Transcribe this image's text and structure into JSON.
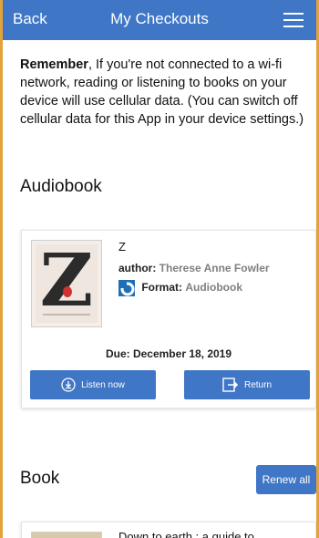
{
  "navbar": {
    "back_label": "Back",
    "title": "My Checkouts",
    "menu_icon": "hamburger-menu-icon"
  },
  "notice": {
    "bold": "Remember",
    "text": ", If you're not connected to a wi-fi network, reading or listening to books on your device will use cellular data. (You can switch off cellular data for this App in your device settings.)"
  },
  "sections": {
    "audiobook_title": "Audiobook",
    "book_title": "Book"
  },
  "audiobook": {
    "title": "Z",
    "author_label": "author:",
    "author": "Therese Anne Fowler",
    "format_label": "Format:",
    "format": "Audiobook",
    "due": "Due: December 18, 2019",
    "listen_label": "Listen now",
    "return_label": "Return"
  },
  "book_list": {
    "renew_all_label": "Renew all",
    "first_title": "Down to earth : a guide to"
  },
  "colors": {
    "accent": "#3f76c6",
    "frame": "#e3a33a"
  }
}
